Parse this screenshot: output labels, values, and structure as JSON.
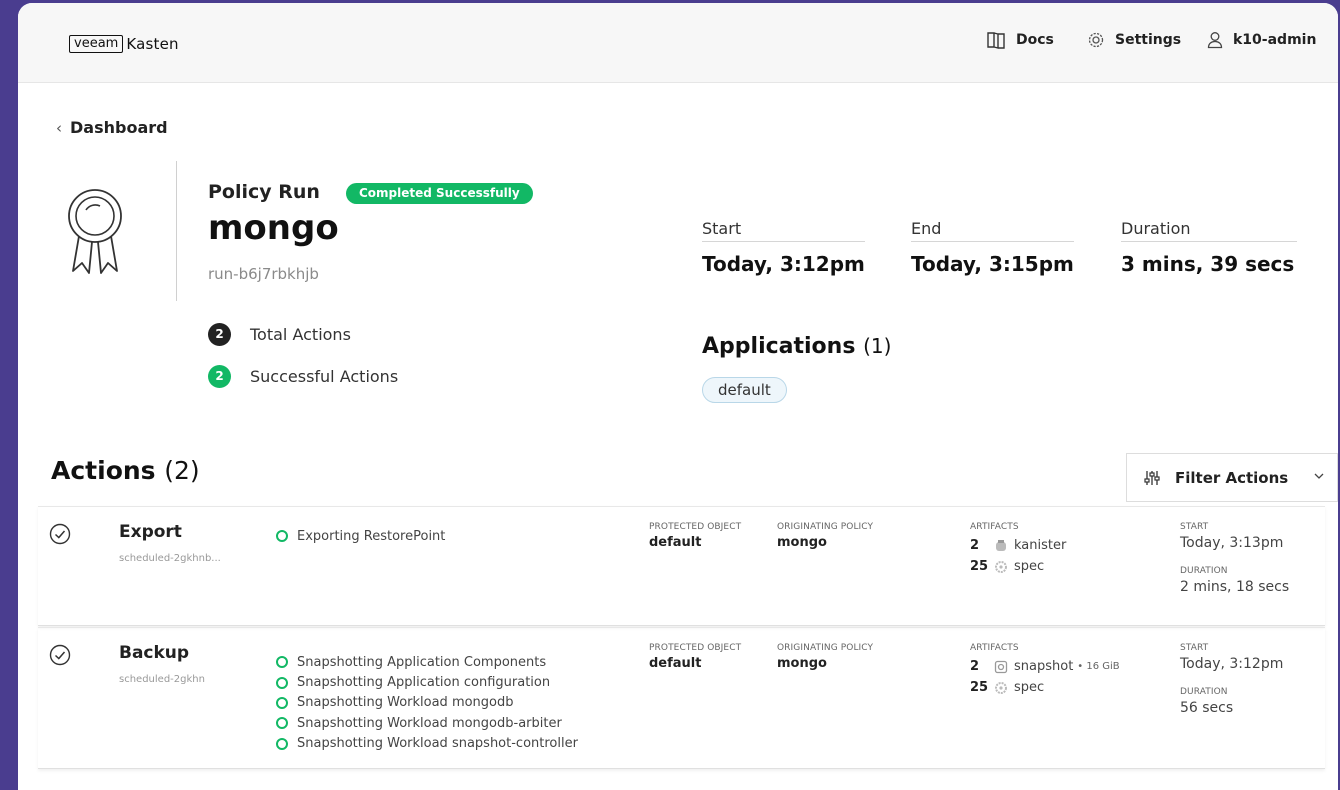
{
  "topbar": {
    "logo_box": "veeam",
    "logo_word": "Kasten",
    "docs_label": "Docs",
    "settings_label": "Settings",
    "user_label": "k10-admin"
  },
  "breadcrumb": {
    "back_label": "Dashboard"
  },
  "run": {
    "label": "Policy Run",
    "status": "Completed Successfully",
    "name": "mongo",
    "id": "run-b6j7rbkhjb",
    "total_actions_count": "2",
    "total_actions_label": "Total Actions",
    "successful_actions_count": "2",
    "successful_actions_label": "Successful Actions"
  },
  "timing": {
    "start_label": "Start",
    "start_value": "Today, 3:12pm",
    "end_label": "End",
    "end_value": "Today, 3:15pm",
    "duration_label": "Duration",
    "duration_value": "3 mins, 39 secs"
  },
  "applications": {
    "title": "Applications",
    "count": "(1)",
    "items": [
      "default"
    ]
  },
  "actions": {
    "title": "Actions",
    "count": "(2)",
    "filter_label": "Filter Actions",
    "protected_object_label": "PROTECTED OBJECT",
    "originating_policy_label": "ORIGINATING POLICY",
    "artifacts_label": "ARTIFACTS",
    "start_label": "START",
    "duration_label": "DURATION",
    "items": [
      {
        "kind": "Export",
        "schedule": "scheduled-2gkhnb...",
        "steps": [
          "Exporting RestorePoint"
        ],
        "protected_object": "default",
        "originating_policy": "mongo",
        "artifacts": [
          {
            "count": "2",
            "name": "kanister",
            "size": "",
            "icon": "kanister-icon"
          },
          {
            "count": "25",
            "name": "spec",
            "size": "",
            "icon": "spec-icon"
          }
        ],
        "start": "Today, 3:13pm",
        "duration": "2 mins, 18 secs"
      },
      {
        "kind": "Backup",
        "schedule": "scheduled-2gkhn",
        "steps": [
          "Snapshotting Application Components",
          "Snapshotting Application configuration",
          "Snapshotting Workload mongodb",
          "Snapshotting Workload mongodb-arbiter",
          "Snapshotting Workload snapshot-controller"
        ],
        "protected_object": "default",
        "originating_policy": "mongo",
        "artifacts": [
          {
            "count": "2",
            "name": "snapshot",
            "size": "• 16 GiB",
            "icon": "snapshot-icon"
          },
          {
            "count": "25",
            "name": "spec",
            "size": "",
            "icon": "spec-icon"
          }
        ],
        "start": "Today, 3:12pm",
        "duration": "56 secs"
      }
    ]
  },
  "colors": {
    "background": "#4a3d8f",
    "success": "#12b865",
    "dark_badge": "#222222"
  }
}
